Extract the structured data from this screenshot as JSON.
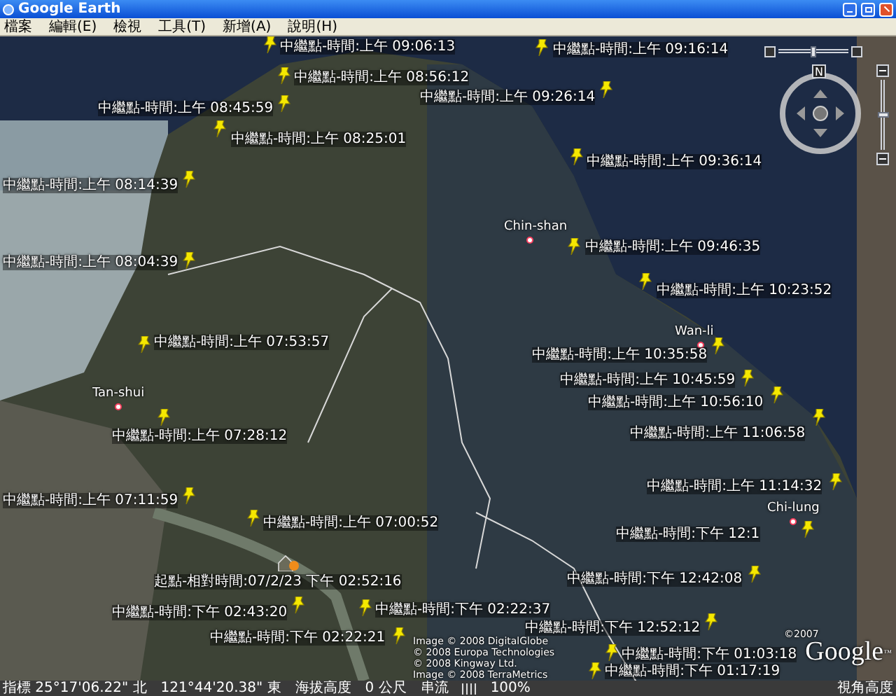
{
  "window": {
    "title": "Google Earth"
  },
  "menu": [
    "檔案",
    "編輯(E)",
    "檢視",
    "工具(T)",
    "新增(A)",
    "說明(H)"
  ],
  "map": {
    "tilt_slider": {
      "level": 0.5
    },
    "compass": {
      "north": "N"
    },
    "zoom_slider": {
      "level": 0.5
    },
    "places": [
      "Chin-shan",
      "Wan-li",
      "Tan-shui",
      "Chi-lung"
    ],
    "placemarks": [
      {
        "kind": "waypoint",
        "label": "中繼點-時間:上午 09:06:13"
      },
      {
        "kind": "waypoint",
        "label": "中繼點-時間:上午 09:16:14"
      },
      {
        "kind": "waypoint",
        "label": "中繼點-時間:上午 08:56:12"
      },
      {
        "kind": "waypoint",
        "label": "中繼點-時間:上午 09:26:14"
      },
      {
        "kind": "waypoint",
        "label": "中繼點-時間:上午 08:45:59"
      },
      {
        "kind": "waypoint",
        "label": "中繼點-時間:上午 08:25:01"
      },
      {
        "kind": "waypoint",
        "label": "中繼點-時間:上午 09:36:14"
      },
      {
        "kind": "waypoint",
        "label": "中繼點-時間:上午 08:14:39"
      },
      {
        "kind": "waypoint",
        "label": "中繼點-時間:上午 09:46:35"
      },
      {
        "kind": "waypoint",
        "label": "中繼點-時間:上午 08:04:39"
      },
      {
        "kind": "waypoint",
        "label": "中繼點-時間:上午 10:23:52"
      },
      {
        "kind": "waypoint",
        "label": "中繼點-時間:上午 07:53:57"
      },
      {
        "kind": "waypoint",
        "label": "中繼點-時間:上午 10:35:58"
      },
      {
        "kind": "waypoint",
        "label": "中繼點-時間:上午 10:45:59"
      },
      {
        "kind": "waypoint",
        "label": "中繼點-時間:上午 10:56:10"
      },
      {
        "kind": "waypoint",
        "label": "中繼點-時間:上午 07:28:12"
      },
      {
        "kind": "waypoint",
        "label": "中繼點-時間:上午 11:06:58"
      },
      {
        "kind": "waypoint",
        "label": "中繼點-時間:上午 11:14:32"
      },
      {
        "kind": "waypoint",
        "label": "中繼點-時間:上午 07:11:59"
      },
      {
        "kind": "waypoint",
        "label": "中繼點-時間:上午 07:00:52"
      },
      {
        "kind": "waypoint",
        "label": "中繼點-時間:下午 12:1"
      },
      {
        "kind": "start",
        "label": "起點-相對時間:07/2/23 下午 02:52:16"
      },
      {
        "kind": "waypoint",
        "label": "中繼點-時間:下午 12:42:08"
      },
      {
        "kind": "waypoint",
        "label": "中繼點-時間:下午 02:43:20"
      },
      {
        "kind": "waypoint",
        "label": "中繼點-時間:下午 02:22:37"
      },
      {
        "kind": "waypoint",
        "label": "中繼點-時間:下午 12:52:12"
      },
      {
        "kind": "waypoint",
        "label": "中繼點-時間:下午 02:22:21"
      },
      {
        "kind": "waypoint",
        "label": "中繼點-時間:下午 01:03:18"
      },
      {
        "kind": "waypoint",
        "label": "中繼點-時間:下午 01:17:19"
      }
    ],
    "copyright": [
      "Image © 2008 DigitalGlobe",
      "© 2008 Europa Technologies",
      "© 2008 Kingway Ltd.",
      "Image © 2008 TerraMetrics"
    ],
    "logo_year": "©2007",
    "logo": "Google",
    "logo_mark": "™"
  },
  "status_bar": {
    "pointer": "指標 25°17'06.22\" 北",
    "longitude": "121°44'20.38\" 東",
    "elevation_label": "海拔高度",
    "elevation": "0 公尺",
    "streaming_label": "串流",
    "streaming": "100%",
    "eye_alt_label": "視角高度"
  }
}
